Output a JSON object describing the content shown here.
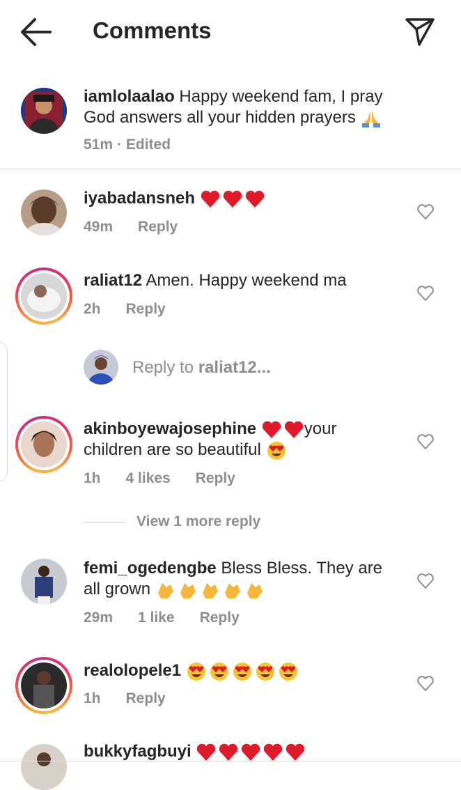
{
  "header": {
    "title": "Comments"
  },
  "caption": {
    "username": "iamlolaalao",
    "text_line1": " Happy weekend fam, I pray",
    "text_line2": "God answers all your hidden prayers",
    "time": "51m",
    "edited": "· Edited"
  },
  "comments": [
    {
      "username": "iyabadansneh",
      "text": "",
      "time": "49m",
      "likes": "",
      "reply": "Reply"
    },
    {
      "username": "raliat12",
      "text": " Amen. Happy weekend ma",
      "time": "2h",
      "likes": "",
      "reply": "Reply"
    },
    {
      "username": "akinboyewajosephine",
      "text_after_hearts": "your",
      "text_line2": "children are so beautiful",
      "time": "1h",
      "likes": "4 likes",
      "reply": "Reply"
    },
    {
      "username": "femi_ogedengbe",
      "text": " Bless Bless. They are",
      "text_line2": "all grown",
      "time": "29m",
      "likes": "1 like",
      "reply": "Reply"
    },
    {
      "username": "realolopele1",
      "text": "",
      "time": "1h",
      "likes": "",
      "reply": "Reply"
    },
    {
      "username": "bukkyfagbuyi",
      "text": ""
    }
  ],
  "reply_input": {
    "prefix": "Reply to ",
    "target": "raliat12..."
  },
  "view_more": "View 1 more reply",
  "colors": {
    "heart_red": "#e0192b",
    "meta_gray": "#8e8e8e",
    "text": "#262626"
  }
}
